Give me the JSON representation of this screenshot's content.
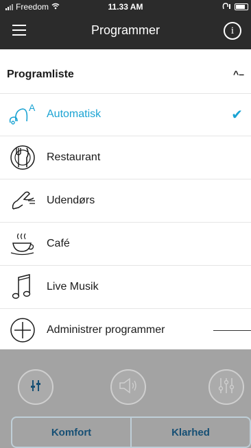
{
  "status": {
    "carrier": "Freedom",
    "time": "11.33 AM"
  },
  "nav": {
    "title": "Programmer"
  },
  "section": {
    "title": "Programliste"
  },
  "programs": [
    {
      "label": "Automatisk",
      "selected": true
    },
    {
      "label": "Restaurant"
    },
    {
      "label": "Udendørs"
    },
    {
      "label": "Café"
    },
    {
      "label": "Live Musik"
    },
    {
      "label": "Administrer programmer"
    }
  ],
  "bottom": {
    "segments": [
      "Komfort",
      "Klarhed"
    ]
  },
  "colors": {
    "accent": "#1aa3d3",
    "bar": "#2b2b2b",
    "overlay": "#a3a3a3",
    "segment_text": "#164f74"
  }
}
